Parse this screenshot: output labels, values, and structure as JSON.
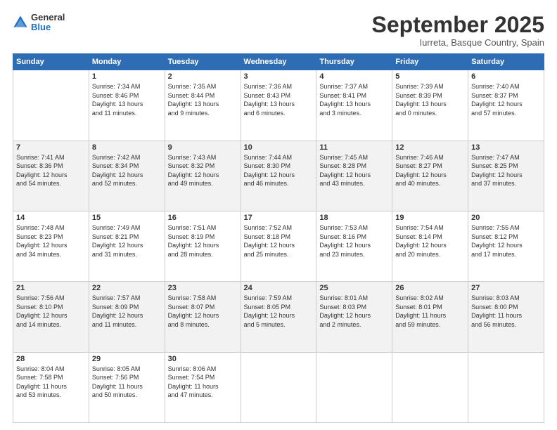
{
  "header": {
    "logo": {
      "general": "General",
      "blue": "Blue"
    },
    "title": "September 2025",
    "location": "Iurreta, Basque Country, Spain"
  },
  "weekdays": [
    "Sunday",
    "Monday",
    "Tuesday",
    "Wednesday",
    "Thursday",
    "Friday",
    "Saturday"
  ],
  "weeks": [
    [
      {
        "num": "",
        "info": ""
      },
      {
        "num": "1",
        "info": "Sunrise: 7:34 AM\nSunset: 8:46 PM\nDaylight: 13 hours\nand 11 minutes."
      },
      {
        "num": "2",
        "info": "Sunrise: 7:35 AM\nSunset: 8:44 PM\nDaylight: 13 hours\nand 9 minutes."
      },
      {
        "num": "3",
        "info": "Sunrise: 7:36 AM\nSunset: 8:43 PM\nDaylight: 13 hours\nand 6 minutes."
      },
      {
        "num": "4",
        "info": "Sunrise: 7:37 AM\nSunset: 8:41 PM\nDaylight: 13 hours\nand 3 minutes."
      },
      {
        "num": "5",
        "info": "Sunrise: 7:39 AM\nSunset: 8:39 PM\nDaylight: 13 hours\nand 0 minutes."
      },
      {
        "num": "6",
        "info": "Sunrise: 7:40 AM\nSunset: 8:37 PM\nDaylight: 12 hours\nand 57 minutes."
      }
    ],
    [
      {
        "num": "7",
        "info": "Sunrise: 7:41 AM\nSunset: 8:36 PM\nDaylight: 12 hours\nand 54 minutes."
      },
      {
        "num": "8",
        "info": "Sunrise: 7:42 AM\nSunset: 8:34 PM\nDaylight: 12 hours\nand 52 minutes."
      },
      {
        "num": "9",
        "info": "Sunrise: 7:43 AM\nSunset: 8:32 PM\nDaylight: 12 hours\nand 49 minutes."
      },
      {
        "num": "10",
        "info": "Sunrise: 7:44 AM\nSunset: 8:30 PM\nDaylight: 12 hours\nand 46 minutes."
      },
      {
        "num": "11",
        "info": "Sunrise: 7:45 AM\nSunset: 8:28 PM\nDaylight: 12 hours\nand 43 minutes."
      },
      {
        "num": "12",
        "info": "Sunrise: 7:46 AM\nSunset: 8:27 PM\nDaylight: 12 hours\nand 40 minutes."
      },
      {
        "num": "13",
        "info": "Sunrise: 7:47 AM\nSunset: 8:25 PM\nDaylight: 12 hours\nand 37 minutes."
      }
    ],
    [
      {
        "num": "14",
        "info": "Sunrise: 7:48 AM\nSunset: 8:23 PM\nDaylight: 12 hours\nand 34 minutes."
      },
      {
        "num": "15",
        "info": "Sunrise: 7:49 AM\nSunset: 8:21 PM\nDaylight: 12 hours\nand 31 minutes."
      },
      {
        "num": "16",
        "info": "Sunrise: 7:51 AM\nSunset: 8:19 PM\nDaylight: 12 hours\nand 28 minutes."
      },
      {
        "num": "17",
        "info": "Sunrise: 7:52 AM\nSunset: 8:18 PM\nDaylight: 12 hours\nand 25 minutes."
      },
      {
        "num": "18",
        "info": "Sunrise: 7:53 AM\nSunset: 8:16 PM\nDaylight: 12 hours\nand 23 minutes."
      },
      {
        "num": "19",
        "info": "Sunrise: 7:54 AM\nSunset: 8:14 PM\nDaylight: 12 hours\nand 20 minutes."
      },
      {
        "num": "20",
        "info": "Sunrise: 7:55 AM\nSunset: 8:12 PM\nDaylight: 12 hours\nand 17 minutes."
      }
    ],
    [
      {
        "num": "21",
        "info": "Sunrise: 7:56 AM\nSunset: 8:10 PM\nDaylight: 12 hours\nand 14 minutes."
      },
      {
        "num": "22",
        "info": "Sunrise: 7:57 AM\nSunset: 8:09 PM\nDaylight: 12 hours\nand 11 minutes."
      },
      {
        "num": "23",
        "info": "Sunrise: 7:58 AM\nSunset: 8:07 PM\nDaylight: 12 hours\nand 8 minutes."
      },
      {
        "num": "24",
        "info": "Sunrise: 7:59 AM\nSunset: 8:05 PM\nDaylight: 12 hours\nand 5 minutes."
      },
      {
        "num": "25",
        "info": "Sunrise: 8:01 AM\nSunset: 8:03 PM\nDaylight: 12 hours\nand 2 minutes."
      },
      {
        "num": "26",
        "info": "Sunrise: 8:02 AM\nSunset: 8:01 PM\nDaylight: 11 hours\nand 59 minutes."
      },
      {
        "num": "27",
        "info": "Sunrise: 8:03 AM\nSunset: 8:00 PM\nDaylight: 11 hours\nand 56 minutes."
      }
    ],
    [
      {
        "num": "28",
        "info": "Sunrise: 8:04 AM\nSunset: 7:58 PM\nDaylight: 11 hours\nand 53 minutes."
      },
      {
        "num": "29",
        "info": "Sunrise: 8:05 AM\nSunset: 7:56 PM\nDaylight: 11 hours\nand 50 minutes."
      },
      {
        "num": "30",
        "info": "Sunrise: 8:06 AM\nSunset: 7:54 PM\nDaylight: 11 hours\nand 47 minutes."
      },
      {
        "num": "",
        "info": ""
      },
      {
        "num": "",
        "info": ""
      },
      {
        "num": "",
        "info": ""
      },
      {
        "num": "",
        "info": ""
      }
    ]
  ]
}
